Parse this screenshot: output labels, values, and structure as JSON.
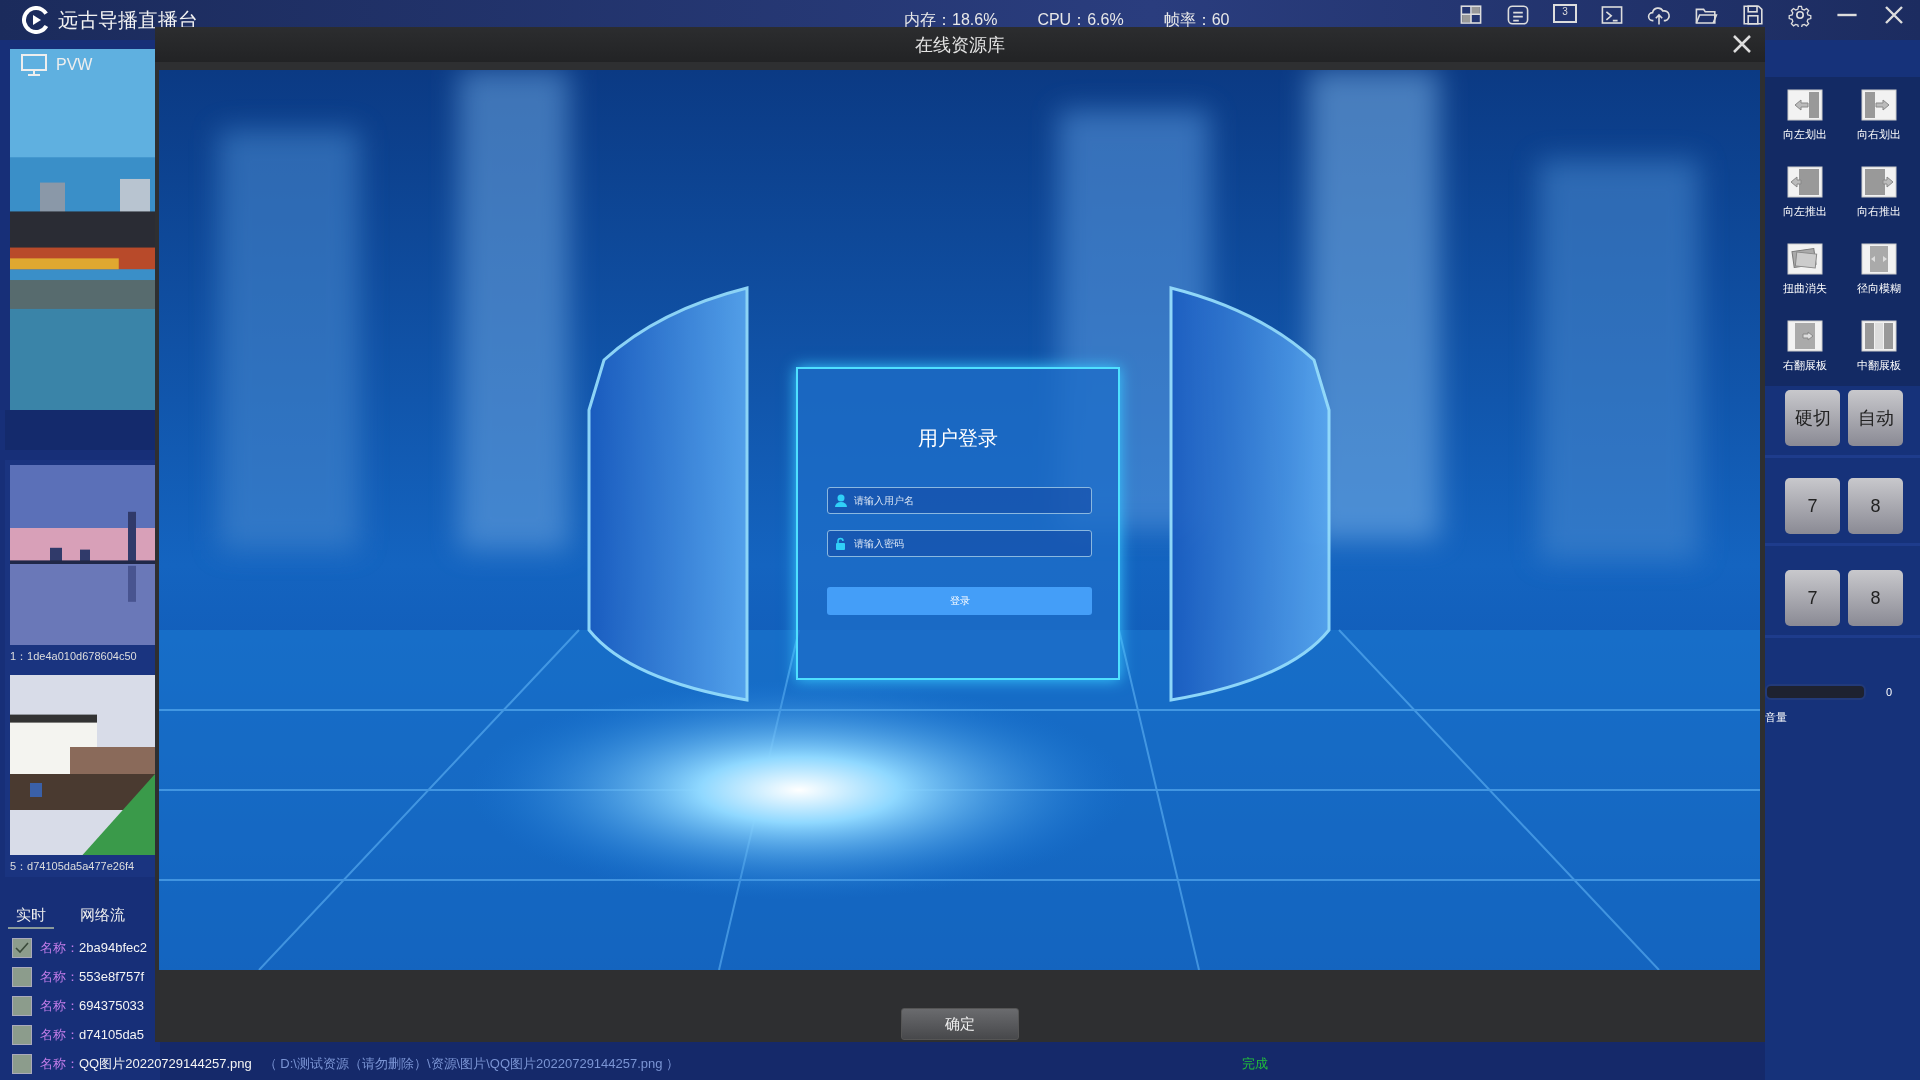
{
  "app": {
    "title": "远古导播直播台",
    "stats": [
      "内存：18.6%",
      "CPU：6.6%",
      "帧率：60"
    ],
    "screen_number": "3"
  },
  "preview": {
    "label": "PVW"
  },
  "sources": [
    {
      "caption": "1：1de4a010d678604c50"
    },
    {
      "caption": "5：d74105da5a477e26f4"
    }
  ],
  "tabs": [
    {
      "label": "实时",
      "selected": true
    },
    {
      "label": "网络流",
      "selected": false
    }
  ],
  "files": [
    {
      "checked": true,
      "label": "名称：",
      "name": "2ba94bfec2"
    },
    {
      "checked": false,
      "label": "名称：",
      "name": "553e8f757f"
    },
    {
      "checked": false,
      "label": "名称：",
      "name": "694375033"
    },
    {
      "checked": false,
      "label": "名称：",
      "name": "d74105da5"
    },
    {
      "checked": false,
      "label": "名称：",
      "name": "QQ图片20220729144257.png",
      "path": "（ D:\\测试资源（请勿删除）\\资源\\图片\\QQ图片20220729144257.png ）",
      "status": "完成"
    }
  ],
  "transitions": [
    {
      "kind": "slide-left",
      "label": "向左划出"
    },
    {
      "kind": "slide-right",
      "label": "向右划出"
    },
    {
      "kind": "push-left",
      "label": "向左推出"
    },
    {
      "kind": "push-right",
      "label": "向右推出"
    },
    {
      "kind": "warp",
      "label": "扭曲消失"
    },
    {
      "kind": "radial-blur",
      "label": "径向模糊"
    },
    {
      "kind": "flip-right",
      "label": "右翻展板"
    },
    {
      "kind": "flip-center",
      "label": "中翻展板"
    }
  ],
  "switch_buttons": [
    "硬切",
    "自动"
  ],
  "bus_rows": [
    {
      "buttons": [
        "7",
        "8"
      ]
    },
    {
      "buttons": [
        "7",
        "8"
      ]
    }
  ],
  "volume": {
    "label": "音量",
    "reading": "0",
    "level": 0
  },
  "dialog": {
    "title": "在线资源库",
    "login": {
      "title": "用户登录",
      "username_placeholder": "请输入用户名",
      "password_placeholder": "请输入密码",
      "button": "登录"
    },
    "confirm": "确定"
  }
}
